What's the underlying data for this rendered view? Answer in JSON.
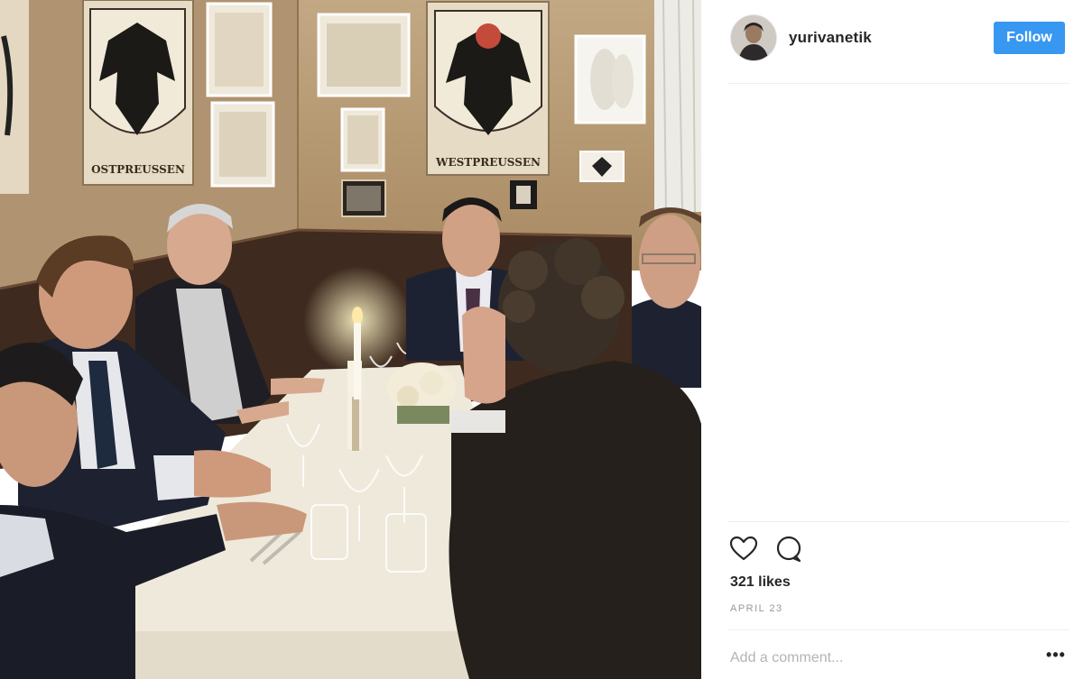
{
  "post": {
    "username": "yurivanetik",
    "follow_label": "Follow",
    "likes": "321 likes",
    "date": "APRIL 23",
    "comment_placeholder": "Add a comment...",
    "more_label": "•••"
  },
  "photo": {
    "banner_left_text": "OSTPREUSSEN",
    "banner_right_text": "WESTPREUSSEN"
  },
  "icons": [
    "heart-icon",
    "comment-icon",
    "more-options-icon"
  ],
  "colors": {
    "follow_button": "#3897f0",
    "wall": "#b79a74",
    "tablecloth": "#efe9dc",
    "text_primary": "#262626"
  }
}
